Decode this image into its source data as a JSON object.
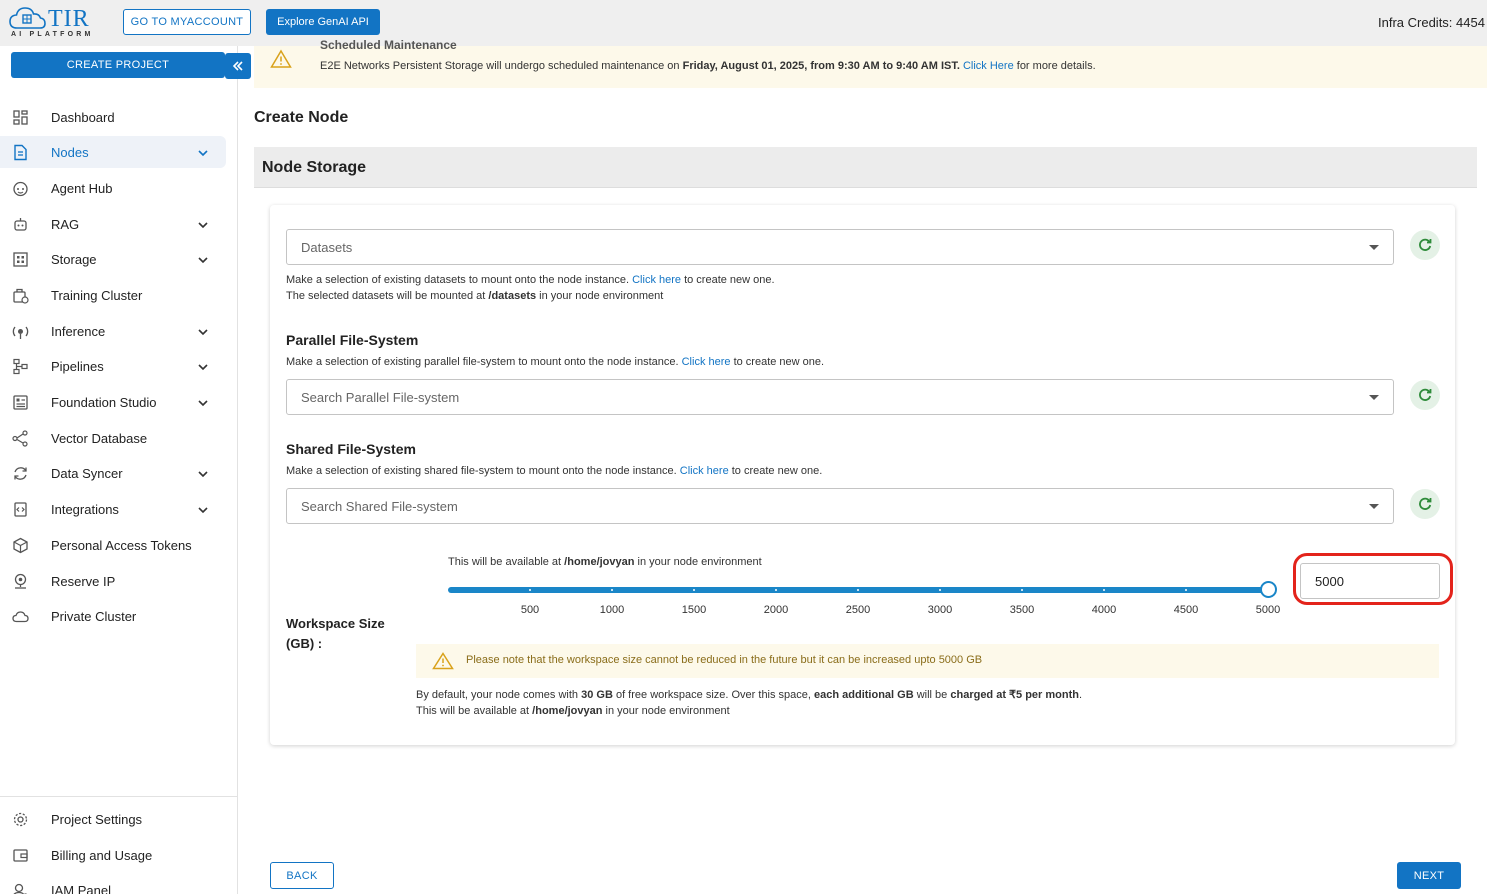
{
  "header": {
    "logo_text": "TIR",
    "logo_sub": "AI PLATFORM",
    "myaccount_label": "GO TO MYACCOUNT",
    "genai_label": "Explore GenAI API",
    "credits_text": "Infra Credits: 4454"
  },
  "sidebar": {
    "create_project_label": "CREATE PROJECT",
    "collapse_icon": "double-chevron-left-icon",
    "items": [
      {
        "label": "Dashboard",
        "icon": "dashboard-icon",
        "expandable": false,
        "active": false
      },
      {
        "label": "Nodes",
        "icon": "document-icon",
        "expandable": true,
        "active": true
      },
      {
        "label": "Agent Hub",
        "icon": "agent-icon",
        "expandable": false,
        "active": false
      },
      {
        "label": "RAG",
        "icon": "robot-icon",
        "expandable": true,
        "active": false
      },
      {
        "label": "Storage",
        "icon": "grid-icon",
        "expandable": true,
        "active": false
      },
      {
        "label": "Training Cluster",
        "icon": "cluster-icon",
        "expandable": false,
        "active": false
      },
      {
        "label": "Inference",
        "icon": "inference-icon",
        "expandable": true,
        "active": false
      },
      {
        "label": "Pipelines",
        "icon": "pipeline-icon",
        "expandable": true,
        "active": false
      },
      {
        "label": "Foundation Studio",
        "icon": "studio-icon",
        "expandable": true,
        "active": false
      },
      {
        "label": "Vector Database",
        "icon": "vector-icon",
        "expandable": false,
        "active": false
      },
      {
        "label": "Data Syncer",
        "icon": "sync-icon",
        "expandable": true,
        "active": false
      },
      {
        "label": "Integrations",
        "icon": "integration-icon",
        "expandable": true,
        "active": false
      },
      {
        "label": "Personal Access Tokens",
        "icon": "token-icon",
        "expandable": false,
        "active": false
      },
      {
        "label": "Reserve IP",
        "icon": "ip-icon",
        "expandable": false,
        "active": false
      },
      {
        "label": "Private Cluster",
        "icon": "cloud-icon",
        "expandable": false,
        "active": false
      }
    ],
    "bottom_items": [
      {
        "label": "Project Settings",
        "icon": "gear-icon"
      },
      {
        "label": "Billing and Usage",
        "icon": "wallet-icon"
      },
      {
        "label": "IAM Panel",
        "icon": "user-icon"
      }
    ]
  },
  "notice": {
    "title": "Scheduled Maintenance",
    "text_prefix": "E2E Networks Persistent Storage will undergo scheduled maintenance on ",
    "text_bold": "Friday, August 01, 2025, from 9:30 AM to 9:40 AM IST.",
    "link": "Click Here",
    "text_suffix": " for more details."
  },
  "page": {
    "title": "Create Node",
    "section_title": "Node Storage"
  },
  "datasets": {
    "placeholder": "Datasets",
    "help1_prefix": "Make a selection of existing datasets to mount onto the node instance. ",
    "help1_link": "Click here",
    "help1_suffix": " to create new one.",
    "help2_prefix": "The selected datasets will be mounted at ",
    "help2_bold": "/datasets",
    "help2_suffix": " in your node environment"
  },
  "parallel_fs": {
    "title": "Parallel File-System",
    "help_prefix": "Make a selection of existing parallel file-system to mount onto the node instance. ",
    "help_link": "Click here",
    "help_suffix": " to create new one.",
    "placeholder": "Search Parallel File-system"
  },
  "shared_fs": {
    "title": "Shared File-System",
    "help_prefix": "Make a selection of existing shared file-system to mount onto the node instance. ",
    "help_link": "Click here",
    "help_suffix": " to create new one.",
    "placeholder": "Search Shared File-system"
  },
  "workspace": {
    "label": "Workspace Size (GB) :",
    "avail_prefix": "This will be available at ",
    "avail_bold": "/home/jovyan",
    "avail_suffix": " in your node environment",
    "slider_min": 0,
    "slider_max": 5000,
    "slider_value": 5000,
    "ticks": [
      "500",
      "1000",
      "1500",
      "2000",
      "2500",
      "3000",
      "3500",
      "4000",
      "4500",
      "5000"
    ],
    "input_value": "5000",
    "warning": "Please note that the workspace size cannot be reduced in the future but it can be increased upto 5000 GB",
    "fine1_a": "By default, your node comes with ",
    "fine1_b": "30 GB",
    "fine1_c": " of free workspace size. Over this space, ",
    "fine1_d": "each additional GB",
    "fine1_e": " will be ",
    "fine1_f": "charged at ₹5 per month",
    "fine1_g": ".",
    "fine2_a": "This will be available at ",
    "fine2_b": "/home/jovyan",
    "fine2_c": " in your node environment"
  },
  "footer": {
    "back_label": "BACK",
    "next_label": "NEXT"
  },
  "colors": {
    "primary": "#1274c4",
    "highlight": "#e3231b",
    "refresh_bg": "#e4f1e6",
    "refresh_icon": "#2e8b3a",
    "warning_bg": "#fdf9ea"
  }
}
